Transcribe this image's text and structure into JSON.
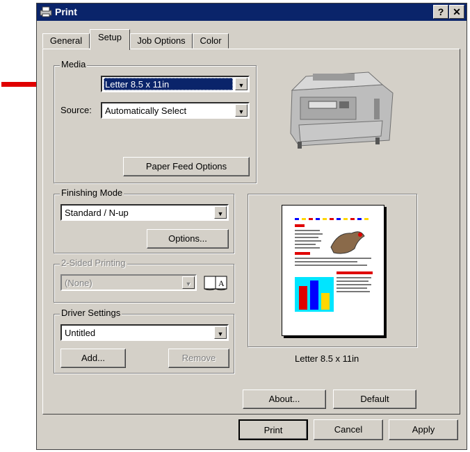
{
  "window": {
    "title": "Print",
    "help_glyph": "?",
    "close_glyph": "✕"
  },
  "tabs": [
    {
      "label": "General"
    },
    {
      "label": "Setup"
    },
    {
      "label": "Job Options"
    },
    {
      "label": "Color"
    }
  ],
  "media": {
    "group_label": "Media",
    "size_value": "Letter 8.5 x 11in",
    "source_label": "Source:",
    "source_value": "Automatically Select",
    "paper_feed_button": "Paper Feed Options"
  },
  "finishing": {
    "group_label": "Finishing Mode",
    "mode_value": "Standard / N-up",
    "options_button": "Options..."
  },
  "two_sided": {
    "group_label": "2-Sided Printing",
    "value": "(None)"
  },
  "driver": {
    "group_label": "Driver Settings",
    "value": "Untitled",
    "add_button": "Add...",
    "remove_button": "Remove"
  },
  "preview": {
    "caption": "Letter 8.5 x 11in"
  },
  "bottom_buttons": {
    "about": "About...",
    "default": "Default"
  },
  "dialog_buttons": {
    "print": "Print",
    "cancel": "Cancel",
    "apply": "Apply"
  },
  "colors": {
    "titlebar": "#0a246a",
    "face": "#d4d0c8",
    "arrow": "#e00000",
    "selection": "#0a246a"
  }
}
